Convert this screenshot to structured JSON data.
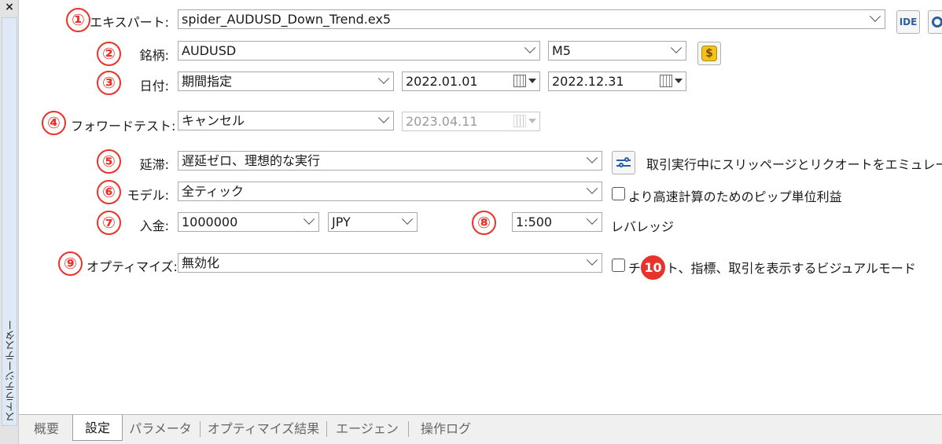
{
  "side_panel": {
    "close_glyph": "×",
    "title": "ストラテジーテスター"
  },
  "rows": {
    "expert": {
      "badge": "①",
      "label": "エキスパート:",
      "value": "spider_AUDUSD_Down_Trend.ex5"
    },
    "symbol": {
      "badge": "②",
      "label": "銘柄:",
      "value": "AUDUSD",
      "timeframe": "M5"
    },
    "date": {
      "badge": "③",
      "label": "日付:",
      "value": "期間指定",
      "from": "2022.01.01",
      "to": "2022.12.31"
    },
    "forward": {
      "badge": "④",
      "label": "フォワードテスト:",
      "value": "キャンセル",
      "date": "2023.04.11"
    },
    "delay": {
      "badge": "⑤",
      "label": "延滞:",
      "value": "遅延ゼロ、理想的な実行",
      "note": "取引実行中にスリッページとリクオートをエミュレートする"
    },
    "model": {
      "badge": "⑥",
      "label": "モデル:",
      "value": "全ティック",
      "checkbox_label": "より高速計算のためのピップ単位利益"
    },
    "deposit": {
      "badge": "⑦",
      "label": "入金:",
      "value": "1000000",
      "currency": "JPY"
    },
    "leverage": {
      "badge": "⑧",
      "value": "1:500",
      "label": "レバレッジ"
    },
    "optimize": {
      "badge": "⑨",
      "label": "オプティマイズ:",
      "value": "無効化",
      "checkbox_label": "チャート、指標、取引を表示するビジュアルモード"
    },
    "visual": {
      "badge": "10"
    }
  },
  "buttons": {
    "ide": "IDE",
    "coin": "$"
  },
  "tabs": [
    "概要",
    "設定",
    "パラメータ",
    "オプティマイズ結果",
    "エージェント",
    "操作ログ"
  ],
  "active_tab": "設定",
  "colors": {
    "badge": "#e8332a",
    "tab_bar": "#f0f0f0",
    "side_strip": "#dfe9f5"
  }
}
